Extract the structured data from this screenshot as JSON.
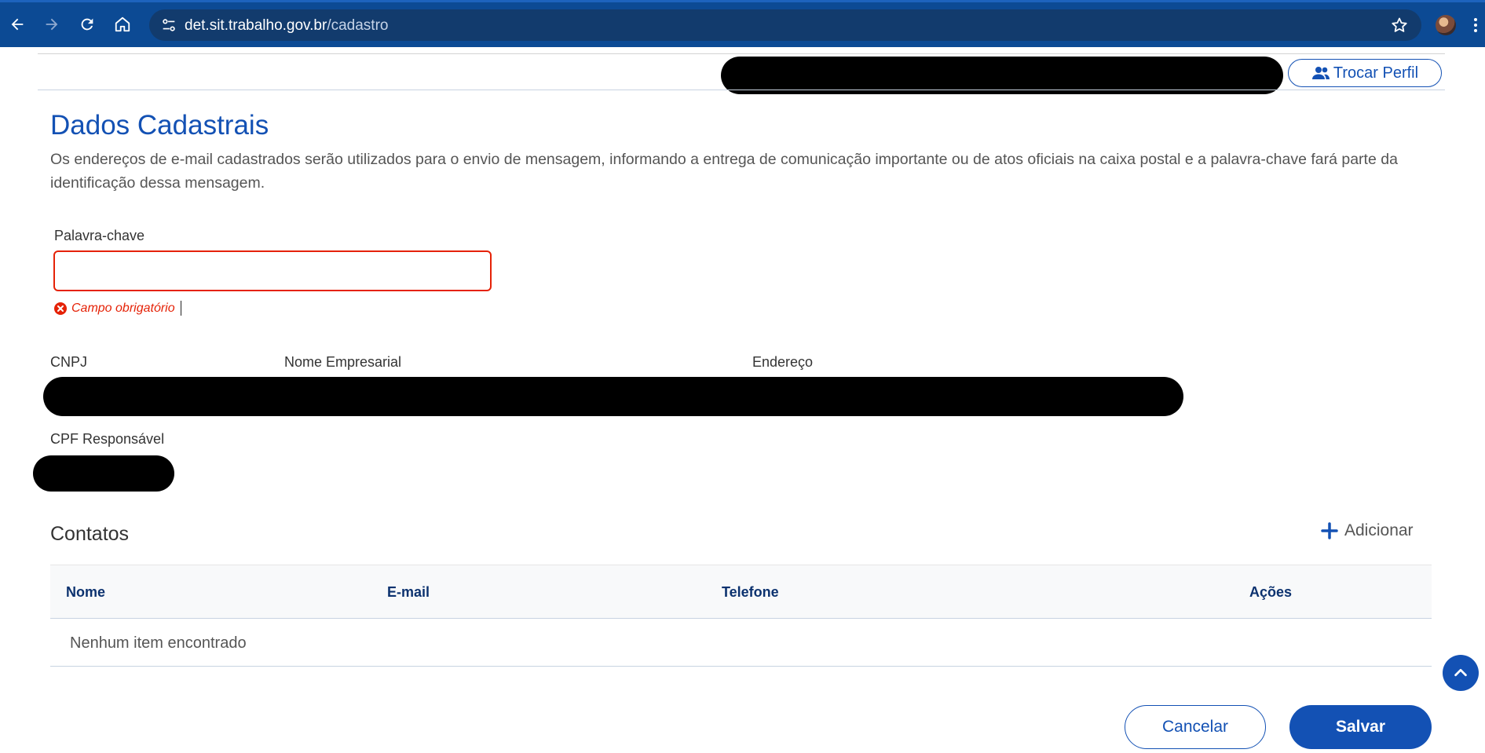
{
  "browser": {
    "url_host": "det.sit.trabalho.gov.br",
    "url_path": "/cadastro"
  },
  "header": {
    "trocar_perfil_label": "Trocar Perfil"
  },
  "main": {
    "title": "Dados Cadastrais",
    "intro": "Os endereços de e-mail cadastrados serão utilizados para o envio de mensagem, informando a entrega de comunicação importante ou de atos oficiais na caixa postal e a palavra-chave fará parte da identificação dessa mensagem.",
    "keyword": {
      "label": "Palavra-chave",
      "value": "",
      "error": "Campo obrigatório"
    },
    "company": {
      "cnpj_label": "CNPJ",
      "nome_label": "Nome Empresarial",
      "endereco_label": "Endereço",
      "cpf_label": "CPF Responsável"
    }
  },
  "contatos": {
    "title": "Contatos",
    "add_label": "Adicionar",
    "columns": [
      "Nome",
      "E-mail",
      "Telefone",
      "Ações"
    ],
    "empty_text": "Nenhum item encontrado"
  },
  "footer": {
    "cancel_label": "Cancelar",
    "save_label": "Salvar"
  },
  "colors": {
    "primary": "#1351b4",
    "error": "#e52207",
    "chrome": "#0c4a94"
  }
}
